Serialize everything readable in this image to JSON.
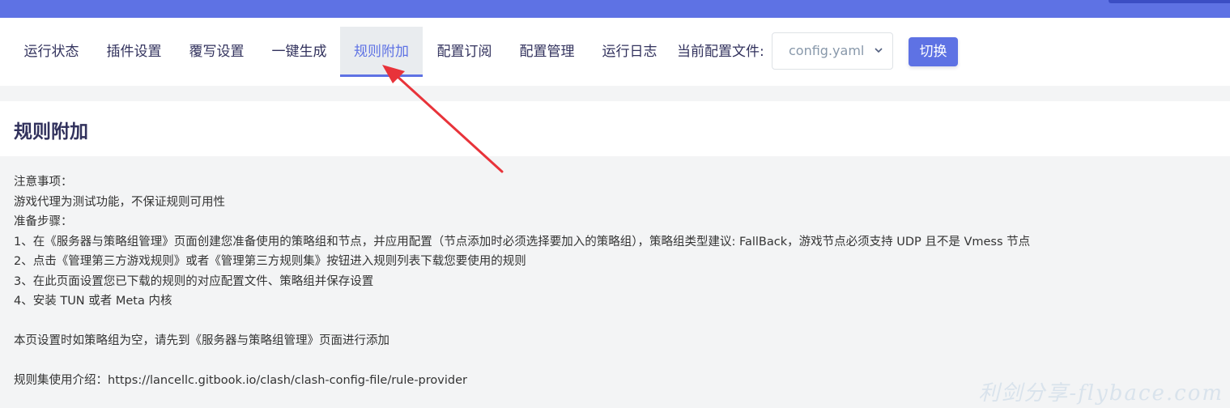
{
  "nav": {
    "tabs": [
      {
        "label": "运行状态"
      },
      {
        "label": "插件设置"
      },
      {
        "label": "覆写设置"
      },
      {
        "label": "一键生成"
      },
      {
        "label": "规则附加"
      },
      {
        "label": "配置订阅"
      },
      {
        "label": "配置管理"
      },
      {
        "label": "运行日志"
      }
    ],
    "active_tab": "规则附加",
    "config_label": "当前配置文件:",
    "config_select_value": "config.yaml",
    "switch_label": "切换"
  },
  "page": {
    "title": "规则附加",
    "lines": [
      "注意事项：",
      "游戏代理为测试功能，不保证规则可用性",
      "准备步骤：",
      "1、在《服务器与策略组管理》页面创建您准备使用的策略组和节点，并应用配置（节点添加时必须选择要加入的策略组），策略组类型建议: FallBack，游戏节点必须支持 UDP 且不是 Vmess 节点",
      "2、点击《管理第三方游戏规则》或者《管理第三方规则集》按钮进入规则列表下载您要使用的规则",
      "3、在此页面设置您已下载的规则的对应配置文件、策略组并保存设置",
      "4、安装 TUN 或者 Meta 内核",
      "本页设置时如策略组为空，请先到《服务器与策略组管理》页面进行添加",
      "规则集使用介绍：https://lancellc.gitbook.io/clash/clash-config-file/rule-provider"
    ]
  },
  "watermark": "利剑分享-flybace.com",
  "colors": {
    "accent": "#5e72e4",
    "arrow": "#e8333a",
    "text_dark": "#32325d"
  }
}
